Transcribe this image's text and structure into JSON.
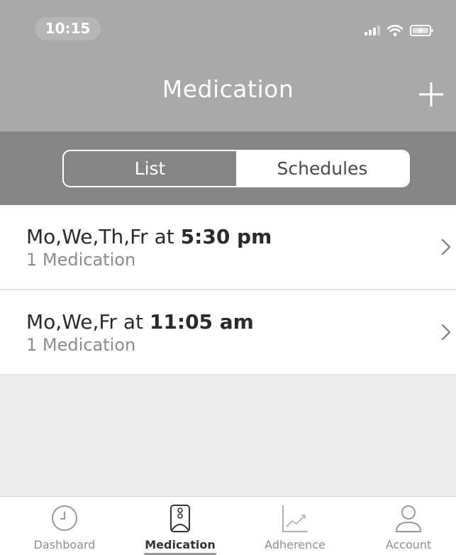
{
  "status_bar": {
    "time": "10:15"
  },
  "header": {
    "title": "Medication",
    "add_icon": "plus-icon"
  },
  "segmented_control": {
    "options": [
      {
        "label": "List",
        "selected": false
      },
      {
        "label": "Schedules",
        "selected": true
      }
    ]
  },
  "schedules": [
    {
      "days": "Mo,We,Th,Fr",
      "connector": "at",
      "time": "5:30 pm",
      "subtitle": "1 Medication"
    },
    {
      "days": "Mo,We,Fr",
      "connector": "at",
      "time": "11:05 am",
      "subtitle": "1 Medication"
    }
  ],
  "tabbar": {
    "tabs": [
      {
        "label": "Dashboard",
        "icon": "clock-icon",
        "active": false
      },
      {
        "label": "Medication",
        "icon": "pill-bottle-icon",
        "active": true
      },
      {
        "label": "Adherence",
        "icon": "chart-icon",
        "active": false
      },
      {
        "label": "Account",
        "icon": "user-icon",
        "active": false
      }
    ]
  },
  "colors": {
    "header_bg": "#a9a9a9",
    "segment_bar_bg": "#858585",
    "empty_area_bg": "#ececec"
  }
}
